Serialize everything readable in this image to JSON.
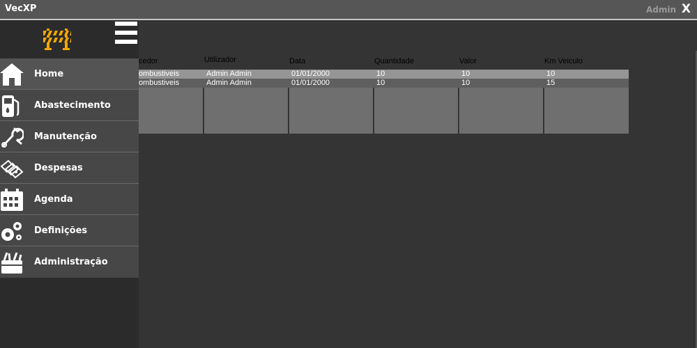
{
  "window": {
    "title": "VecXP",
    "user": "Admin",
    "close_label": "X"
  },
  "sidebar": {
    "logo_icon": "road-barrier-icon",
    "menu_icon": "hamburger-menu-icon",
    "items": [
      {
        "label": "Home",
        "icon": "home-icon"
      },
      {
        "label": "Abastecimento",
        "icon": "fuel-pump-icon"
      },
      {
        "label": "Manutenção",
        "icon": "wrench-icon"
      },
      {
        "label": "Despesas",
        "icon": "money-icon"
      },
      {
        "label": "Agenda",
        "icon": "calendar-icon"
      },
      {
        "label": "Definições",
        "icon": "gears-icon"
      },
      {
        "label": "Administração",
        "icon": "toolbox-icon"
      }
    ]
  },
  "grid": {
    "columns": [
      "cedor",
      "Utilizador",
      "Data",
      "Quantidade",
      "Valor",
      "Km Veiculo"
    ],
    "rows": [
      [
        "ombustiveis",
        "Admin Admin",
        "01/01/2000",
        "10",
        "10",
        "10"
      ],
      [
        "ombustiveis",
        "Admin Admin",
        "01/01/2000",
        "10",
        "10",
        "15"
      ]
    ]
  },
  "colors": {
    "accent": "#f5a800",
    "background": "#343434",
    "sidebar": "#2b2b2b"
  }
}
